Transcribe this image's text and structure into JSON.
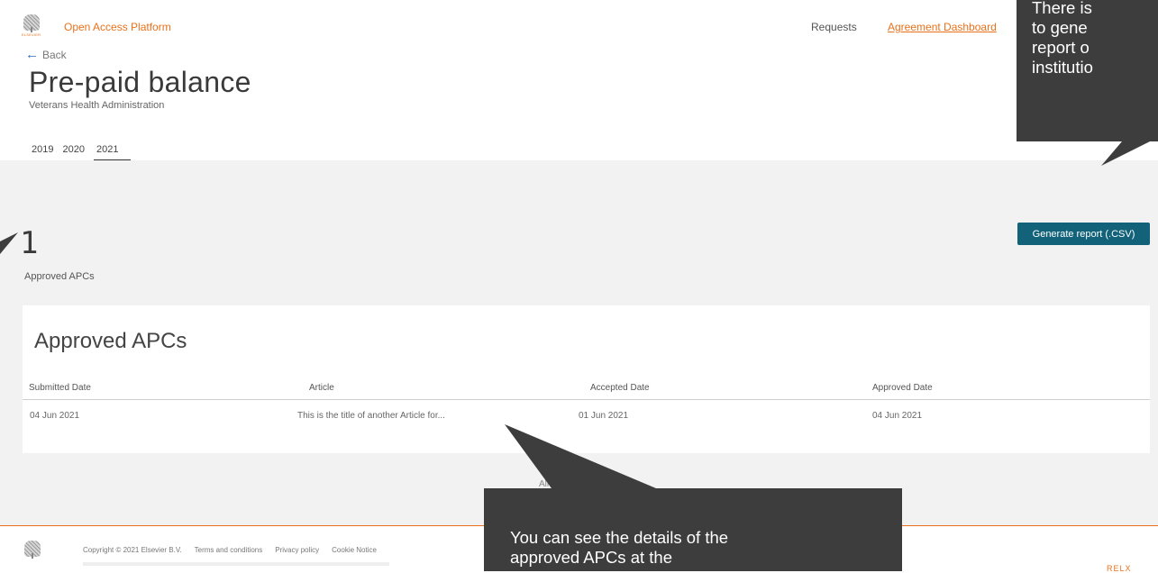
{
  "header": {
    "logo_word": "ELSEVIER",
    "app_title": "Open Access Platform",
    "nav": {
      "requests": "Requests",
      "dashboard": "Agreement Dashboard"
    }
  },
  "back_label": "Back",
  "page": {
    "title": "Pre-paid balance",
    "subtitle": "Veterans Health Administration"
  },
  "year_tabs": {
    "items": [
      "2019",
      "2020",
      "2021"
    ],
    "active": "2021"
  },
  "summary": {
    "count": "1",
    "count_label": "Approved APCs",
    "generate_button": "Generate report (.CSV)"
  },
  "table": {
    "title": "Approved APCs",
    "headers": [
      "Submitted Date",
      "Article",
      "Accepted Date",
      "Approved Date"
    ],
    "rows": [
      [
        "04 Jun 2021",
        "This is the title of another Article for...",
        "01 Jun 2021",
        "04 Jun 2021"
      ]
    ]
  },
  "below_table_text": "All",
  "footer": {
    "links": [
      "Copyright © 2021 Elsevier B.V.",
      "Terms and conditions",
      "Privacy policy",
      "Cookie Notice"
    ],
    "brand": "RELX"
  },
  "callouts": {
    "top": "There is\nto gene\nreport o\ninstitutio",
    "bottom": "You can see the details of the\napproved APCs at the"
  },
  "colors": {
    "accent": "#e9711c",
    "button": "#12627a",
    "callout": "#3d3d3d",
    "band": "#f2f2f2"
  }
}
